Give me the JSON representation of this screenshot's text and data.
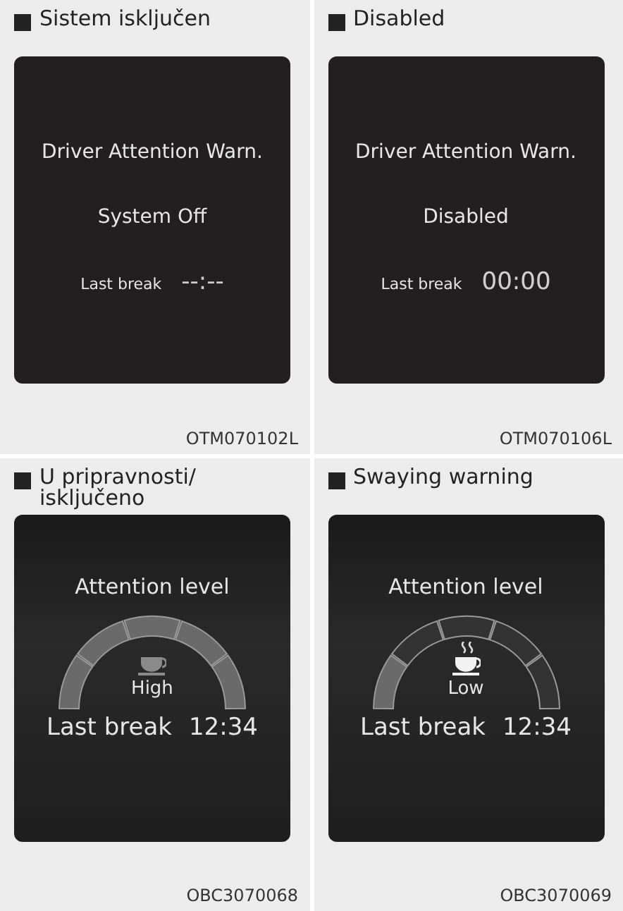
{
  "panels": [
    {
      "caption": "Sistem isključen",
      "code": "OTM070102L",
      "screen": {
        "kind": "text",
        "title": "Driver Attention Warn.",
        "status": "System Off",
        "break_label": "Last break",
        "break_time": "--:--"
      }
    },
    {
      "caption": "Disabled",
      "code": "OTM070106L",
      "screen": {
        "kind": "text",
        "title": "Driver Attention Warn.",
        "status": "Disabled",
        "break_label": "Last break",
        "break_time": "00:00"
      }
    },
    {
      "caption": "U pripravnosti/ isključeno",
      "code": "OBC3070068",
      "screen": {
        "kind": "gauge",
        "title": "Attention level",
        "status": "High",
        "segments": [
          {
            "lit": true
          },
          {
            "lit": true
          },
          {
            "lit": true
          },
          {
            "lit": true
          },
          {
            "lit": true
          }
        ],
        "steam": false,
        "break_label": "Last break",
        "break_time": "12:34"
      }
    },
    {
      "caption": "Swaying warning",
      "code": "OBC3070069",
      "screen": {
        "kind": "gauge",
        "title": "Attention level",
        "status": "Low",
        "segments": [
          {
            "lit": true
          },
          {
            "lit": false
          },
          {
            "lit": false
          },
          {
            "lit": false
          },
          {
            "lit": false
          }
        ],
        "steam": true,
        "break_label": "Last break",
        "break_time": "12:34"
      }
    }
  ]
}
